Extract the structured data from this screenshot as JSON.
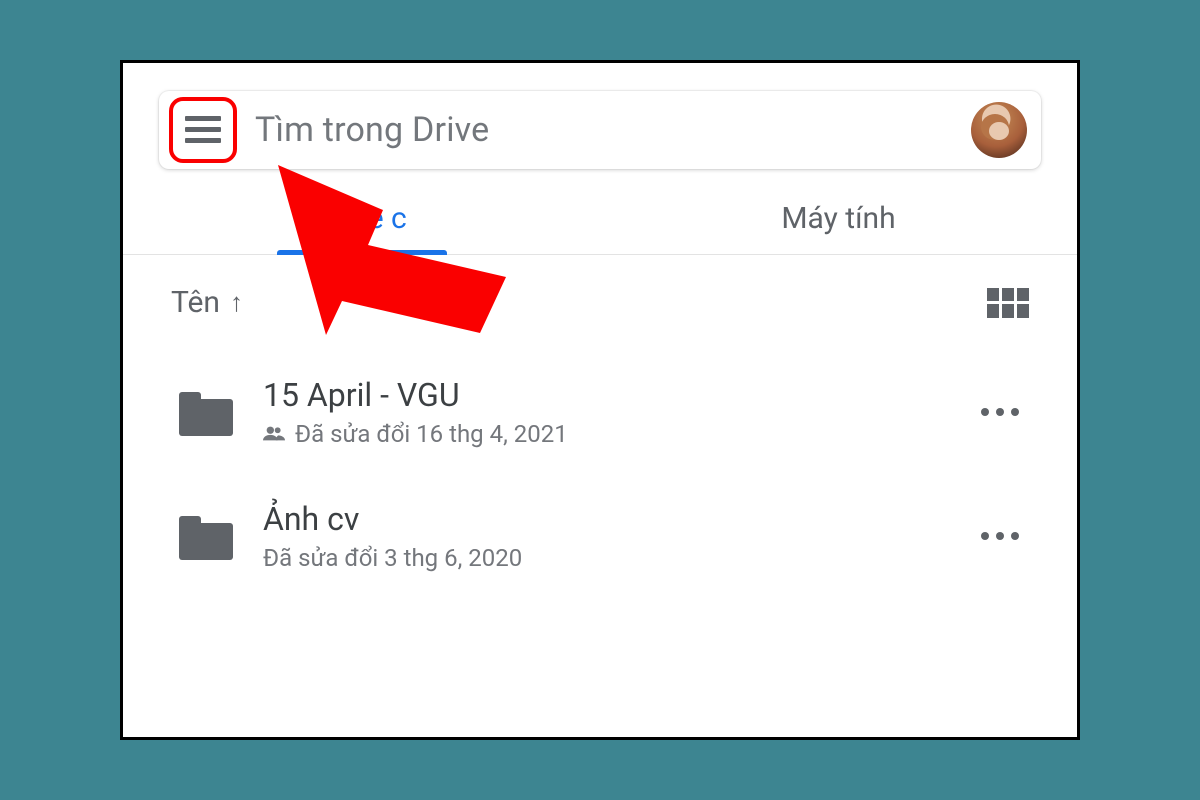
{
  "search": {
    "placeholder": "Tìm trong Drive"
  },
  "tabs": {
    "drive": "Drive c",
    "computer": "Máy tính"
  },
  "sort": {
    "label": "Tên"
  },
  "files": [
    {
      "title": "15 April - VGU",
      "subtitle": "Đã sửa đổi 16 thg 4, 2021",
      "shared": true
    },
    {
      "title": "Ảnh cv",
      "subtitle": "Đã sửa đổi 3 thg 6, 2020",
      "shared": false
    }
  ]
}
